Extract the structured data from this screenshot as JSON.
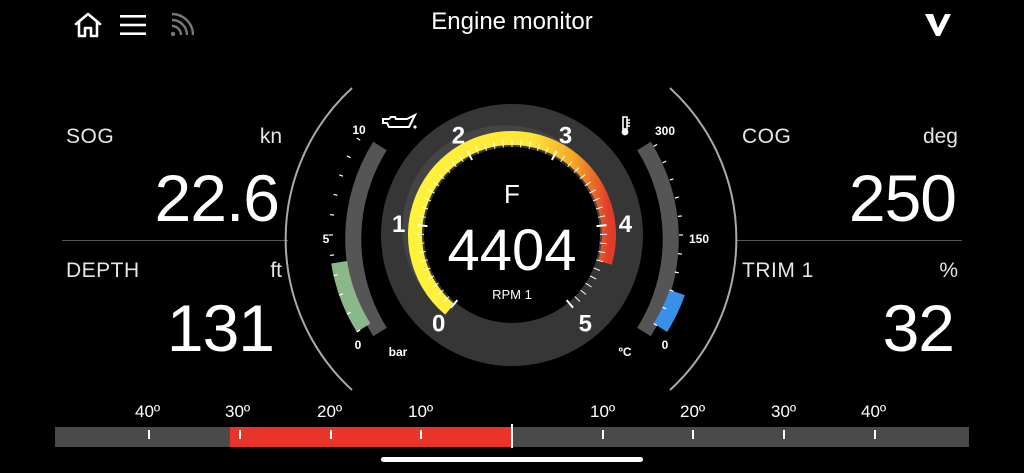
{
  "header": {
    "title": "Engine monitor",
    "icons": [
      "home-icon",
      "menu-icon",
      "signal-icon",
      "brand-logo-icon"
    ]
  },
  "left_panel": {
    "sog": {
      "label": "SOG",
      "unit": "kn",
      "value": "22.6"
    },
    "depth": {
      "label": "DEPTH",
      "unit": "ft",
      "value": "131"
    }
  },
  "right_panel": {
    "cog": {
      "label": "COG",
      "unit": "deg",
      "value": "250"
    },
    "trim": {
      "label": "TRIM 1",
      "unit": "%",
      "value": "32"
    }
  },
  "gauge": {
    "rpm": {
      "value": "4404",
      "letter": "F",
      "label": "RPM 1",
      "numeric_value": 4.404,
      "scale_min": 0,
      "scale_max": 5,
      "ticks": [
        "0",
        "1",
        "2",
        "3",
        "4",
        "5"
      ],
      "colors": [
        "#fff23a",
        "#ffd23a",
        "#f5a623",
        "#e03c2a"
      ]
    },
    "oil": {
      "icon": "oil-can-icon",
      "unit": "bar",
      "min": "0",
      "mid": "5",
      "max": "10",
      "value_fraction": 0.36,
      "color": "#8bb88a"
    },
    "temp": {
      "icon": "thermometer-icon",
      "unit": "ºC",
      "min": "0",
      "mid": "150",
      "max": "300",
      "value_fraction": 0.2,
      "color": "#3a8fe8"
    }
  },
  "heel_bar": {
    "labels_left": [
      "40º",
      "30º",
      "20º",
      "10º"
    ],
    "labels_right": [
      "10º",
      "20º",
      "30º",
      "40º"
    ],
    "value_degrees": -31,
    "range_degrees": 50,
    "fill_color": "#e8342a",
    "track_color": "#4a4a4a"
  }
}
